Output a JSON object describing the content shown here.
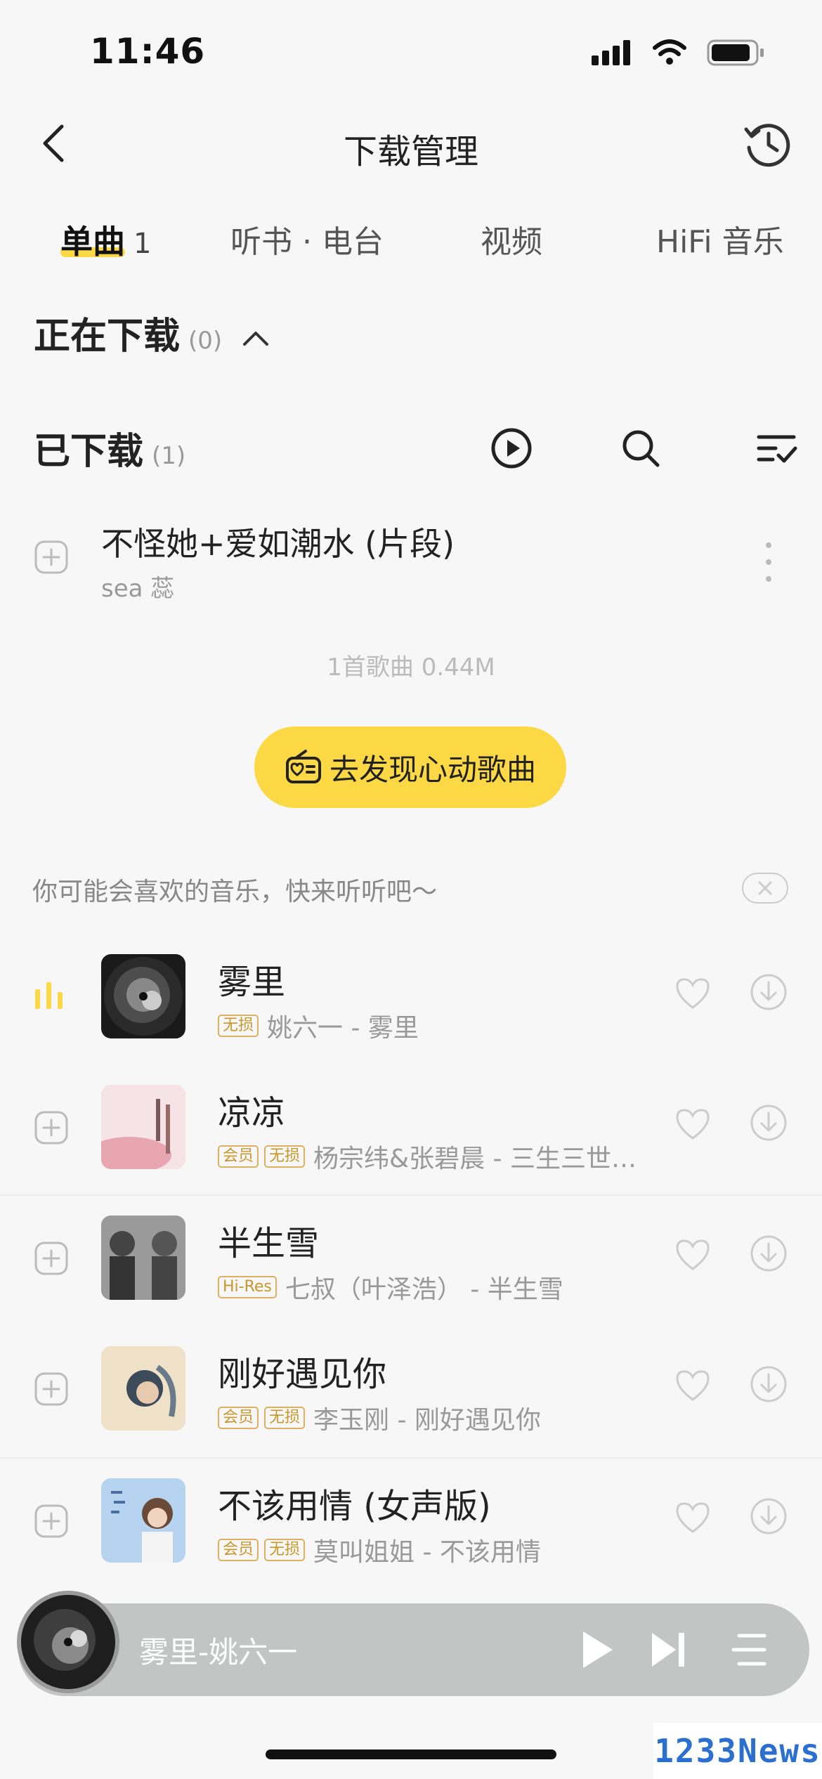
{
  "status_bar": {
    "time": "11:46"
  },
  "nav": {
    "title": "下载管理"
  },
  "tabs": [
    {
      "label": "单曲",
      "count": "1"
    },
    {
      "label": "听书 · 电台"
    },
    {
      "label": "视频"
    },
    {
      "label": "HiFi 音乐"
    }
  ],
  "downloading": {
    "title": "正在下载",
    "count": "(0)"
  },
  "downloaded": {
    "title": "已下载",
    "count": "(1)",
    "songs": [
      {
        "title": "不怪她+爱如潮水 (片段)",
        "artist": "sea 蕊"
      }
    ],
    "summary": "1首歌曲 0.44M"
  },
  "discover_button": {
    "label": "去发现心动歌曲"
  },
  "recommend": {
    "header": "你可能会喜欢的音乐，快来听听吧～",
    "items": [
      {
        "title": "雾里",
        "badges": [
          "无损"
        ],
        "subtitle": "姚六一 - 雾里",
        "playing": true
      },
      {
        "title": "凉凉",
        "badges": [
          "会员",
          "无损"
        ],
        "subtitle": "杨宗纬&张碧晨 - 三生三世…"
      },
      {
        "title": "半生雪",
        "badges": [
          "Hi-Res"
        ],
        "subtitle": "七叔（叶泽浩） - 半生雪"
      },
      {
        "title": "刚好遇见你",
        "badges": [
          "会员",
          "无损"
        ],
        "subtitle": "李玉刚 - 刚好遇见你"
      },
      {
        "title": "不该用情 (女声版)",
        "badges": [
          "会员",
          "无损"
        ],
        "subtitle": "莫叫姐姐 - 不该用情"
      }
    ]
  },
  "player": {
    "now_playing": "雾里-姚六一"
  },
  "watermark": "1233News",
  "colors": {
    "accent": "#fbd844",
    "badge": "#c9962b",
    "player_bg": "#c3c5c4"
  }
}
